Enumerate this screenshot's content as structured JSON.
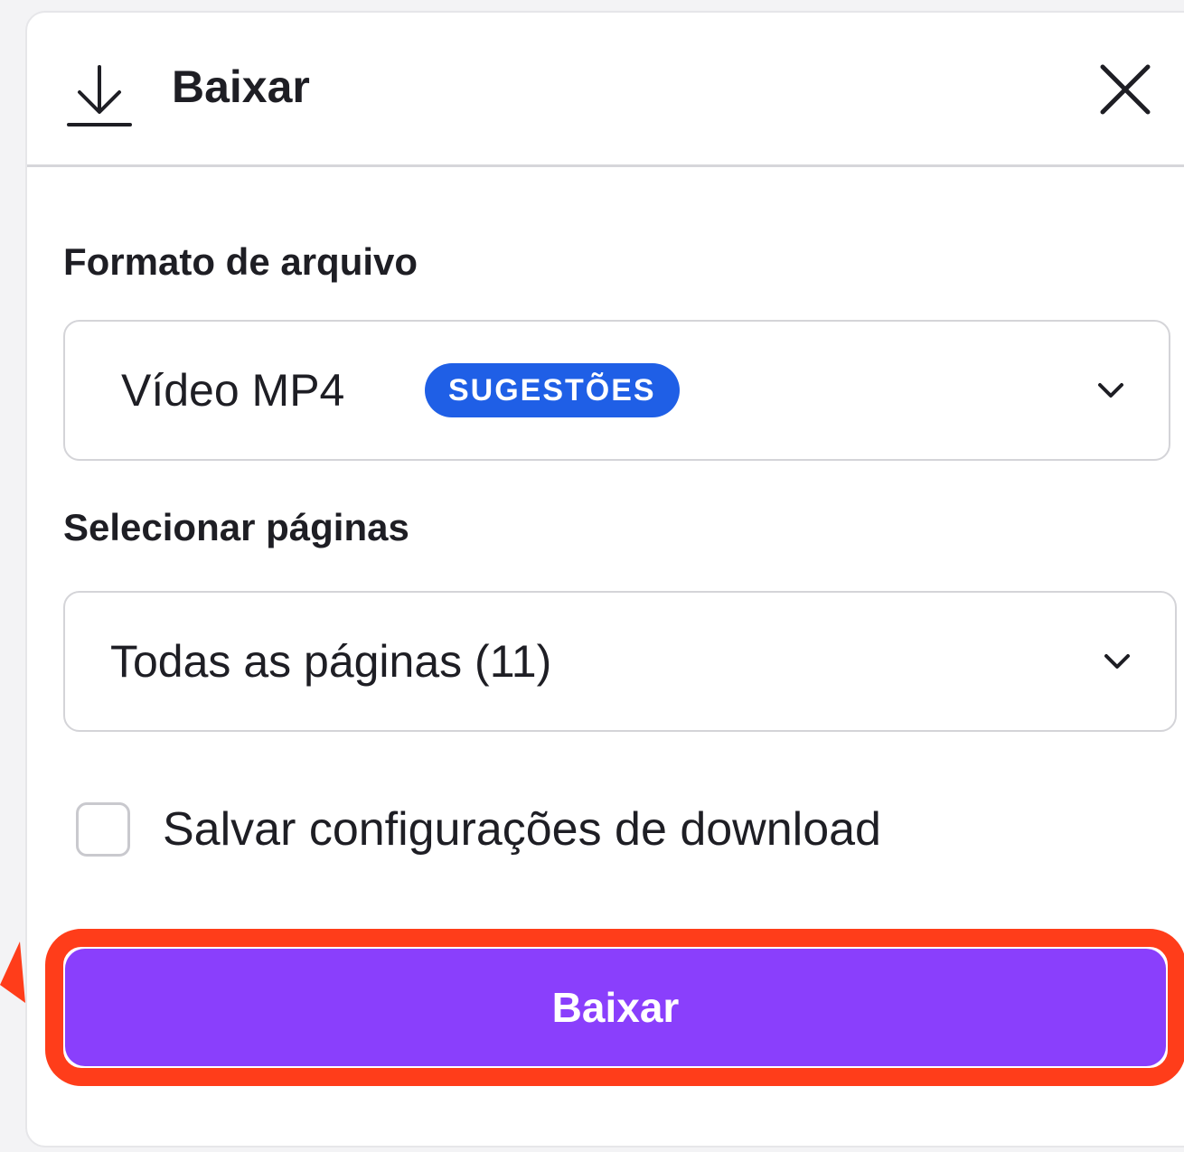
{
  "header": {
    "title": "Baixar",
    "icon": "download-icon",
    "close_icon": "close-icon"
  },
  "file_format": {
    "label": "Formato de arquivo",
    "selected": "Vídeo MP4",
    "badge": "SUGESTÕES",
    "badge_color": "#1f5fe6"
  },
  "pages": {
    "label": "Selecionar páginas",
    "selected": "Todas as páginas (11)"
  },
  "save_settings": {
    "label": "Salvar configurações de download",
    "checked": false
  },
  "download_button": {
    "label": "Baixar",
    "color": "#8a3ffc",
    "highlight_color": "#ff3d1a"
  }
}
